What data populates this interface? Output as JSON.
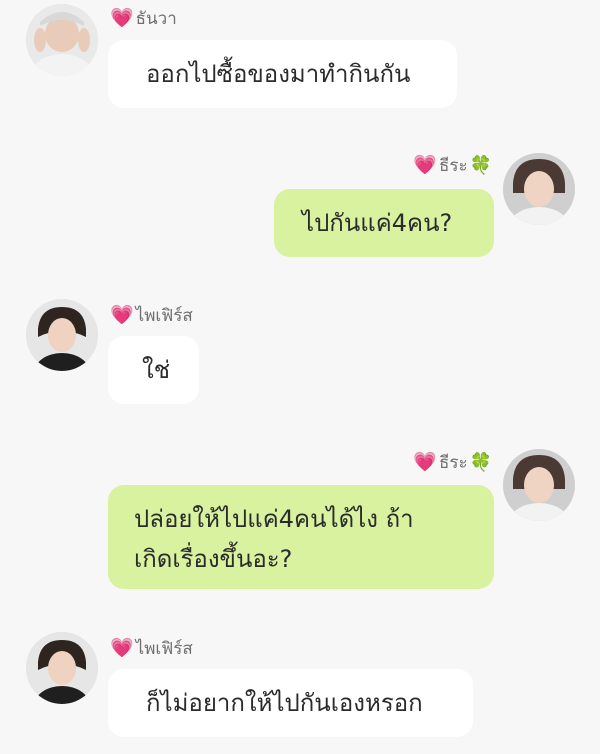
{
  "messages": [
    {
      "side": "left",
      "sender": "ธันวา",
      "text": [
        "ออกไปซื้อของมาทำกินกัน"
      ]
    },
    {
      "side": "right",
      "sender": "ธีระ",
      "text": [
        "ไปกันแค่4คน?"
      ]
    },
    {
      "side": "left",
      "sender": "ไพเฟิร์ส",
      "text": [
        "ใช่"
      ]
    },
    {
      "side": "right",
      "sender": "ธีระ",
      "text": [
        "ปล่อยให้ไปแค่4คนได้ไง ถ้า",
        "เกิดเรื่องขึ้นอะ?"
      ]
    },
    {
      "side": "left",
      "sender": "ไพเฟิร์ส",
      "text": [
        "ก็ไม่อยากให้ไปกันเองหรอก"
      ]
    }
  ],
  "icons": {
    "heart": "heart-icon",
    "clover": "clover-icon"
  },
  "colors": {
    "background": "#f7f7f7",
    "left_bubble": "#ffffff",
    "right_bubble": "#d8f2a0",
    "heart": "#ea4c89",
    "clover": "#59a83a",
    "name_text": "#6f6f6f"
  }
}
